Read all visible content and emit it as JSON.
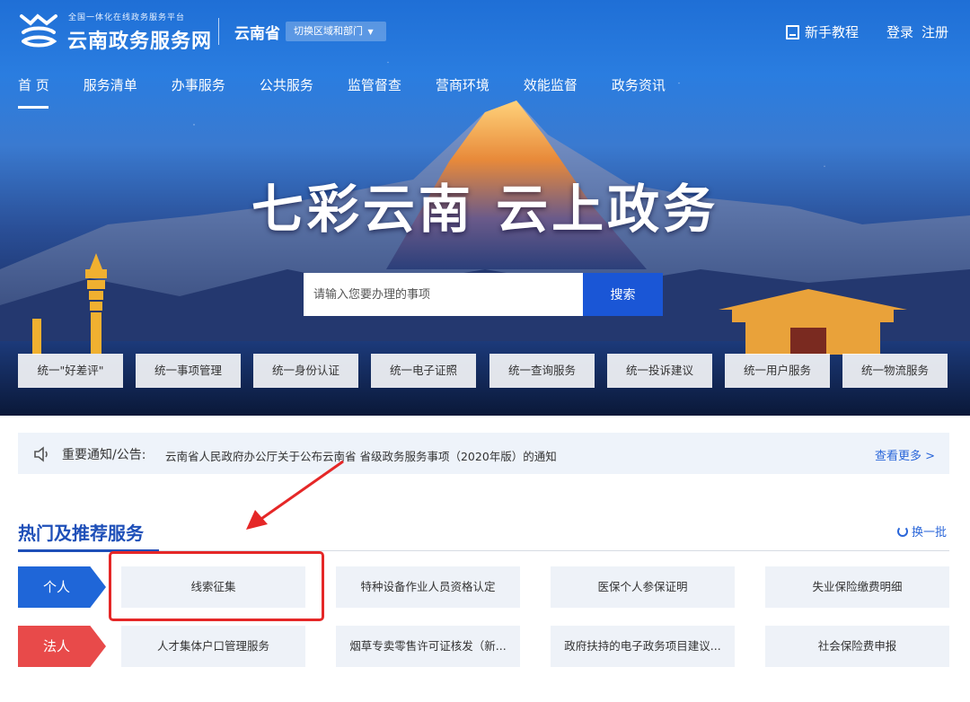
{
  "header": {
    "logo_subtitle": "全国一体化在线政务服务平台",
    "logo_title": "云南政务服务网",
    "province": "云南省",
    "switch_label": "切换区域和部门",
    "tutorial": "新手教程",
    "login": "登录",
    "register": "注册"
  },
  "nav": {
    "items": [
      "首 页",
      "服务清单",
      "办事服务",
      "公共服务",
      "监管督查",
      "营商环境",
      "效能监督",
      "政务资讯"
    ],
    "active_index": 0
  },
  "hero": {
    "slogan": "七彩云南  云上政务"
  },
  "search": {
    "placeholder": "请输入您要办理的事项",
    "button": "搜索"
  },
  "unify_services": [
    "统一\"好差评\"",
    "统一事项管理",
    "统一身份认证",
    "统一电子证照",
    "统一查询服务",
    "统一投诉建议",
    "统一用户服务",
    "统一物流服务"
  ],
  "notice": {
    "label": "重要通知/公告:",
    "text": "云南省人民政府办公厅关于公布云南省 省级政务服务事项（2020年版）的通知",
    "more": "查看更多 >"
  },
  "hot_services": {
    "title": "热门及推荐服务",
    "refresh": "换一批",
    "tags": {
      "personal": "个人",
      "legal": "法人"
    },
    "personal": [
      "线索征集",
      "特种设备作业人员资格认定",
      "医保个人参保证明",
      "失业保险缴费明细"
    ],
    "legal": [
      "人才集体户口管理服务",
      "烟草专卖零售许可证核发（新...",
      "政府扶持的电子政务项目建议...",
      "社会保险费申报"
    ]
  },
  "colors": {
    "primary": "#1f66d8",
    "legal_red": "#e84a4a",
    "highlight_red": "#e52727",
    "title_blue": "#1e4fb8"
  }
}
